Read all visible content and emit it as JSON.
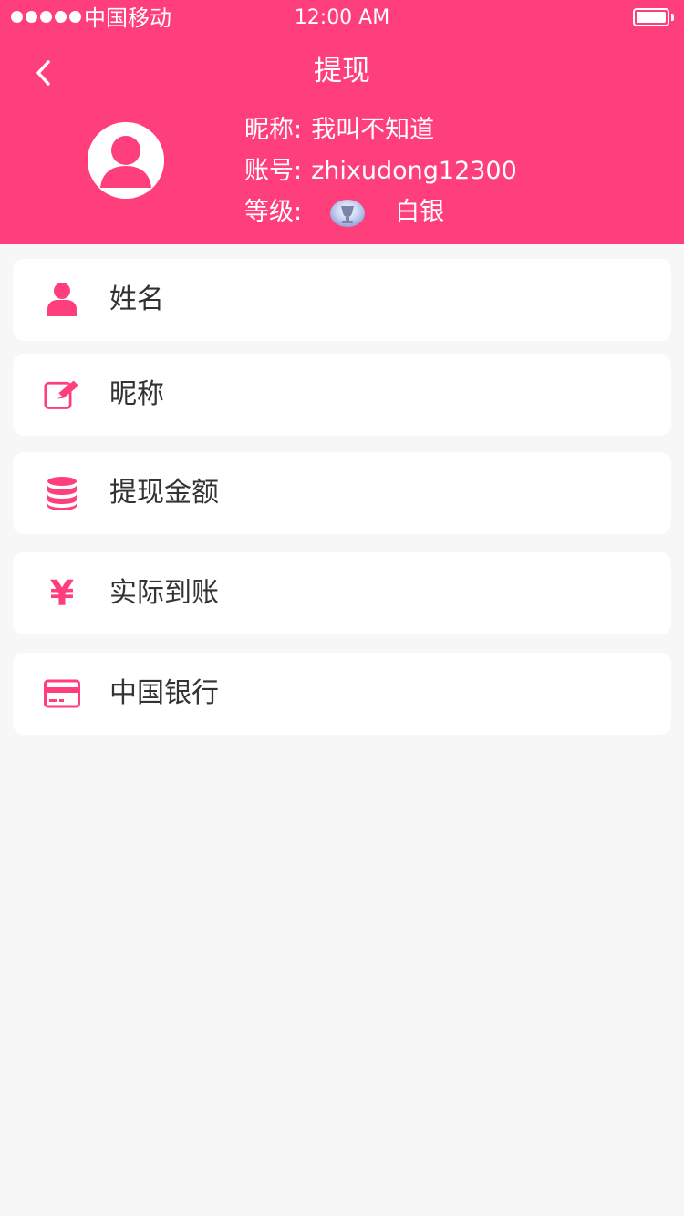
{
  "status_bar": {
    "carrier": "中国移动",
    "time": "12:00 AM"
  },
  "header": {
    "title": "提现"
  },
  "profile": {
    "nickname_label": "昵称:",
    "nickname_value": "我叫不知道",
    "account_label": "账号:",
    "account_value": "zhixudong12300",
    "level_label": "等级:",
    "level_value": "白银"
  },
  "list": {
    "items": [
      {
        "label": "姓名",
        "icon": "user-icon"
      },
      {
        "label": "昵称",
        "icon": "edit-icon"
      },
      {
        "label": "提现金额",
        "icon": "database-icon"
      },
      {
        "label": "实际到账",
        "icon": "yen-icon",
        "glyph": "¥"
      },
      {
        "label": "中国银行",
        "icon": "credit-card-icon"
      }
    ]
  },
  "colors": {
    "accent": "#ff3f7c",
    "background": "#f7f7f7",
    "card": "#ffffff"
  }
}
